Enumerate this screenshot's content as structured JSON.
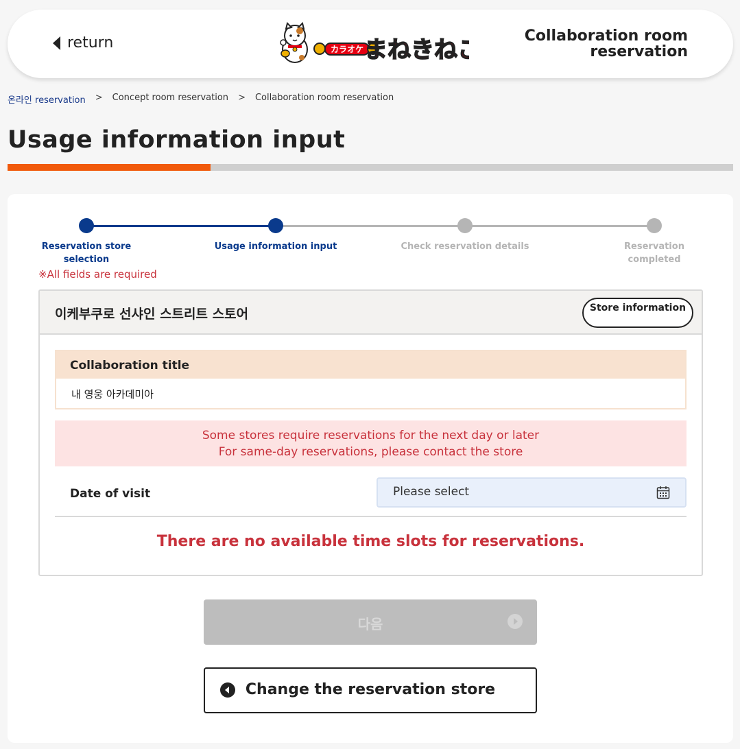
{
  "header": {
    "back_label": "return",
    "title": "Collaboration room reservation",
    "logo": {
      "prefix_text": "カラオケ",
      "brand_text": "まねきねこ",
      "colors": {
        "red": "#e60012",
        "gold": "#f0b000",
        "dark": "#222222"
      }
    }
  },
  "breadcrumb": {
    "items": [
      "온라인 reservation",
      "Concept room reservation",
      "Collaboration room reservation"
    ],
    "separator": ">"
  },
  "page": {
    "title": "Usage information input",
    "progress_fraction": 0.28
  },
  "steps": [
    {
      "label": "Reservation store selection",
      "state": "done"
    },
    {
      "label": "Usage information input",
      "state": "current"
    },
    {
      "label": "Check reservation details",
      "state": "pending"
    },
    {
      "label": "Reservation completed",
      "state": "pending"
    }
  ],
  "form": {
    "required_note": "※All fields are required",
    "store_name": "이케부쿠로 선샤인 스트리트 스토어",
    "store_info_button": "Store information",
    "collab_title_label": "Collaboration title",
    "collab_title_value": "내 영웅 아카데미아",
    "notice_line1": "Some stores require reservations for the next day or later",
    "notice_line2": "For same-day reservations, please contact the store",
    "date_label": "Date of visit",
    "date_placeholder": "Please select",
    "no_slots_message": "There are no available time slots for reservations."
  },
  "buttons": {
    "next_label": "다음",
    "change_store_label": "Change the reservation store"
  },
  "colors": {
    "accent_orange": "#f15a0c",
    "step_active": "#0a3a8c",
    "step_inactive": "#b5b5b5",
    "error_red": "#c8323c",
    "notice_bg": "#fde3e3",
    "collab_header_bg": "#f8e2d0",
    "date_input_bg": "#e9f0fb"
  }
}
